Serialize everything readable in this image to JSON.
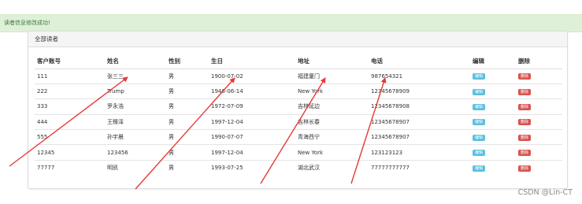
{
  "alert": {
    "message": "读者信息修改成功!"
  },
  "panel": {
    "title": "全部读者"
  },
  "table": {
    "headers": [
      "客户账号",
      "姓名",
      "性别",
      "生日",
      "地址",
      "电话",
      "编辑",
      "删除"
    ],
    "edit_label": "编辑",
    "delete_label": "删除",
    "rows": [
      [
        "111",
        "张三三",
        "男",
        "1900-07-02",
        "福建厦门",
        "987654321"
      ],
      [
        "222",
        "Trump",
        "男",
        "1946-06-14",
        "New York",
        "12345678909"
      ],
      [
        "333",
        "罗永浩",
        "男",
        "1972-07-09",
        "吉林延边",
        "12345678908"
      ],
      [
        "444",
        "王臻泽",
        "男",
        "1997-12-04",
        "吉林长春",
        "12345678907"
      ],
      [
        "555",
        "孙宇晨",
        "男",
        "1990-07-07",
        "青海西宁",
        "12345678907"
      ],
      [
        "12345",
        "123456",
        "男",
        "1997-12-04",
        "New York",
        "123123123"
      ],
      [
        "77777",
        "明凯",
        "男",
        "1993-07-25",
        "湖北武汉",
        "77777777777"
      ]
    ]
  },
  "annotation": {
    "arrow_color": "#e53935"
  },
  "watermark": {
    "text": "CSDN @Lin-CT"
  }
}
